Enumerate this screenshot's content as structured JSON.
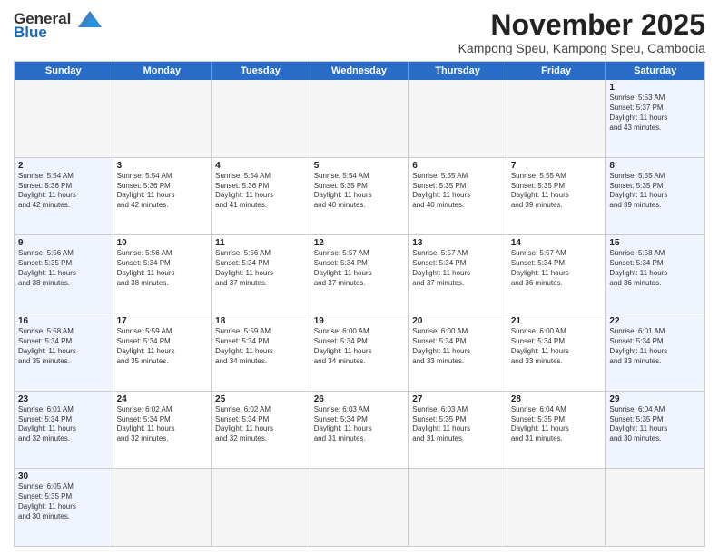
{
  "header": {
    "logo_general": "General",
    "logo_blue": "Blue",
    "month_title": "November 2025",
    "subtitle": "Kampong Speu, Kampong Speu, Cambodia"
  },
  "weekdays": [
    "Sunday",
    "Monday",
    "Tuesday",
    "Wednesday",
    "Thursday",
    "Friday",
    "Saturday"
  ],
  "rows": [
    [
      {
        "day": "",
        "text": "",
        "empty": true
      },
      {
        "day": "",
        "text": "",
        "empty": true
      },
      {
        "day": "",
        "text": "",
        "empty": true
      },
      {
        "day": "",
        "text": "",
        "empty": true
      },
      {
        "day": "",
        "text": "",
        "empty": true
      },
      {
        "day": "",
        "text": "",
        "empty": true
      },
      {
        "day": "1",
        "text": "Sunrise: 5:53 AM\nSunset: 5:37 PM\nDaylight: 11 hours\nand 43 minutes.",
        "weekend": true
      }
    ],
    [
      {
        "day": "2",
        "text": "Sunrise: 5:54 AM\nSunset: 5:36 PM\nDaylight: 11 hours\nand 42 minutes.",
        "weekend": true
      },
      {
        "day": "3",
        "text": "Sunrise: 5:54 AM\nSunset: 5:36 PM\nDaylight: 11 hours\nand 42 minutes."
      },
      {
        "day": "4",
        "text": "Sunrise: 5:54 AM\nSunset: 5:36 PM\nDaylight: 11 hours\nand 41 minutes."
      },
      {
        "day": "5",
        "text": "Sunrise: 5:54 AM\nSunset: 5:35 PM\nDaylight: 11 hours\nand 40 minutes."
      },
      {
        "day": "6",
        "text": "Sunrise: 5:55 AM\nSunset: 5:35 PM\nDaylight: 11 hours\nand 40 minutes."
      },
      {
        "day": "7",
        "text": "Sunrise: 5:55 AM\nSunset: 5:35 PM\nDaylight: 11 hours\nand 39 minutes."
      },
      {
        "day": "8",
        "text": "Sunrise: 5:55 AM\nSunset: 5:35 PM\nDaylight: 11 hours\nand 39 minutes.",
        "weekend": true
      }
    ],
    [
      {
        "day": "9",
        "text": "Sunrise: 5:56 AM\nSunset: 5:35 PM\nDaylight: 11 hours\nand 38 minutes.",
        "weekend": true
      },
      {
        "day": "10",
        "text": "Sunrise: 5:56 AM\nSunset: 5:34 PM\nDaylight: 11 hours\nand 38 minutes."
      },
      {
        "day": "11",
        "text": "Sunrise: 5:56 AM\nSunset: 5:34 PM\nDaylight: 11 hours\nand 37 minutes."
      },
      {
        "day": "12",
        "text": "Sunrise: 5:57 AM\nSunset: 5:34 PM\nDaylight: 11 hours\nand 37 minutes."
      },
      {
        "day": "13",
        "text": "Sunrise: 5:57 AM\nSunset: 5:34 PM\nDaylight: 11 hours\nand 37 minutes."
      },
      {
        "day": "14",
        "text": "Sunrise: 5:57 AM\nSunset: 5:34 PM\nDaylight: 11 hours\nand 36 minutes."
      },
      {
        "day": "15",
        "text": "Sunrise: 5:58 AM\nSunset: 5:34 PM\nDaylight: 11 hours\nand 36 minutes.",
        "weekend": true
      }
    ],
    [
      {
        "day": "16",
        "text": "Sunrise: 5:58 AM\nSunset: 5:34 PM\nDaylight: 11 hours\nand 35 minutes.",
        "weekend": true
      },
      {
        "day": "17",
        "text": "Sunrise: 5:59 AM\nSunset: 5:34 PM\nDaylight: 11 hours\nand 35 minutes."
      },
      {
        "day": "18",
        "text": "Sunrise: 5:59 AM\nSunset: 5:34 PM\nDaylight: 11 hours\nand 34 minutes."
      },
      {
        "day": "19",
        "text": "Sunrise: 6:00 AM\nSunset: 5:34 PM\nDaylight: 11 hours\nand 34 minutes."
      },
      {
        "day": "20",
        "text": "Sunrise: 6:00 AM\nSunset: 5:34 PM\nDaylight: 11 hours\nand 33 minutes."
      },
      {
        "day": "21",
        "text": "Sunrise: 6:00 AM\nSunset: 5:34 PM\nDaylight: 11 hours\nand 33 minutes."
      },
      {
        "day": "22",
        "text": "Sunrise: 6:01 AM\nSunset: 5:34 PM\nDaylight: 11 hours\nand 33 minutes.",
        "weekend": true
      }
    ],
    [
      {
        "day": "23",
        "text": "Sunrise: 6:01 AM\nSunset: 5:34 PM\nDaylight: 11 hours\nand 32 minutes.",
        "weekend": true
      },
      {
        "day": "24",
        "text": "Sunrise: 6:02 AM\nSunset: 5:34 PM\nDaylight: 11 hours\nand 32 minutes."
      },
      {
        "day": "25",
        "text": "Sunrise: 6:02 AM\nSunset: 5:34 PM\nDaylight: 11 hours\nand 32 minutes."
      },
      {
        "day": "26",
        "text": "Sunrise: 6:03 AM\nSunset: 5:34 PM\nDaylight: 11 hours\nand 31 minutes."
      },
      {
        "day": "27",
        "text": "Sunrise: 6:03 AM\nSunset: 5:35 PM\nDaylight: 11 hours\nand 31 minutes."
      },
      {
        "day": "28",
        "text": "Sunrise: 6:04 AM\nSunset: 5:35 PM\nDaylight: 11 hours\nand 31 minutes."
      },
      {
        "day": "29",
        "text": "Sunrise: 6:04 AM\nSunset: 5:35 PM\nDaylight: 11 hours\nand 30 minutes.",
        "weekend": true
      }
    ],
    [
      {
        "day": "30",
        "text": "Sunrise: 6:05 AM\nSunset: 5:35 PM\nDaylight: 11 hours\nand 30 minutes.",
        "weekend": true
      },
      {
        "day": "",
        "text": "",
        "empty": true
      },
      {
        "day": "",
        "text": "",
        "empty": true
      },
      {
        "day": "",
        "text": "",
        "empty": true
      },
      {
        "day": "",
        "text": "",
        "empty": true
      },
      {
        "day": "",
        "text": "",
        "empty": true
      },
      {
        "day": "",
        "text": "",
        "empty": true
      }
    ]
  ]
}
